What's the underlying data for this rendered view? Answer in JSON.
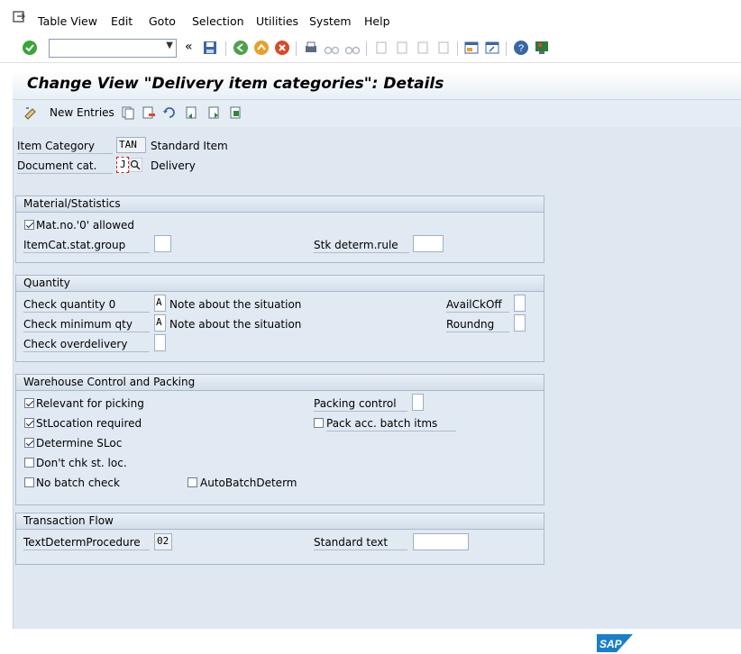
{
  "menu": [
    "Table View",
    "Edit",
    "Goto",
    "Selection",
    "Utilities",
    "System",
    "Help"
  ],
  "window": {
    "title": "Change View \"Delivery item categories\": Details"
  },
  "app_toolbar": {
    "new_entries": "New Entries"
  },
  "header": {
    "item_category_label": "Item Category",
    "item_category_value": "TAN",
    "item_category_desc": "Standard Item",
    "document_cat_label": "Document cat.",
    "document_cat_value": "J",
    "document_cat_desc": "Delivery"
  },
  "material_statistics": {
    "title": "Material/Statistics",
    "mat_no_zero_label": "Mat.no.'0' allowed",
    "mat_no_zero_checked": true,
    "itemcat_stat_group_label": "ItemCat.stat.group",
    "stk_determ_rule_label": "Stk determ.rule"
  },
  "quantity": {
    "title": "Quantity",
    "check_qty0_label": "Check quantity 0",
    "check_qty0_value": "A",
    "check_qty0_desc": "Note about the situation",
    "check_min_qty_label": "Check minimum qty",
    "check_min_qty_value": "A",
    "check_min_qty_desc": "Note about the situation",
    "check_overdelivery_label": "Check overdelivery",
    "availckoff_label": "AvailCkOff",
    "roundng_label": "Roundng"
  },
  "warehouse": {
    "title": "Warehouse Control and Packing",
    "relevant_picking": "Relevant for picking",
    "stlocation_required": "StLocation required",
    "determine_sloc": "Determine SLoc",
    "dont_chk_stloc": "Don't chk st. loc.",
    "no_batch_check": "No batch check",
    "autobatchdeterm": "AutoBatchDeterm",
    "packing_control_label": "Packing control",
    "pack_acc_batch": "Pack acc. batch itms"
  },
  "transaction_flow": {
    "title": "Transaction Flow",
    "textdeterm_label": "TextDetermProcedure",
    "textdeterm_value": "02",
    "standard_text_label": "Standard text"
  },
  "brand": {
    "logo_text": "SAP"
  }
}
